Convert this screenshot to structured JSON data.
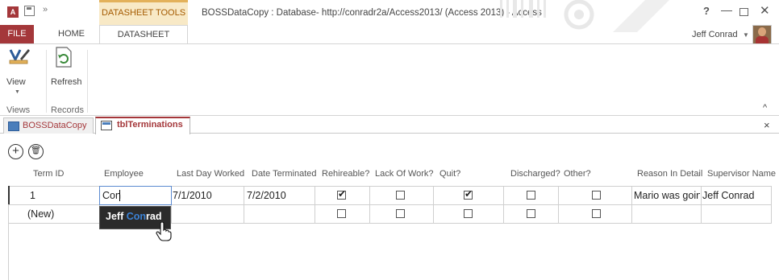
{
  "app": {
    "icon_text": "A",
    "tools_context": "DATASHEET TOOLS",
    "window_title": "BOSSDataCopy : Database- http://conradr2a/Access2013/ (Access 2013) - Access",
    "help": "?",
    "qat_more": "»"
  },
  "ribbon": {
    "tabs": [
      {
        "label": "FILE"
      },
      {
        "label": "HOME"
      },
      {
        "label": "DATASHEET"
      }
    ],
    "user_name": "Jeff Conrad",
    "view_label": "View",
    "refresh_label": "Refresh",
    "groups": {
      "views": "Views",
      "records": "Records"
    },
    "collapse": "^"
  },
  "doc_tabs": [
    {
      "label": "BOSSDataCopy"
    },
    {
      "label": "tblTerminations"
    }
  ],
  "doc_close": "×",
  "columns": [
    "Term ID",
    "Employee",
    "Last Day Worked",
    "Date Terminated",
    "Rehireable?",
    "Lack Of Work?",
    "Quit?",
    "Discharged?",
    "Other?",
    "Reason In Detail",
    "Supervisor Name"
  ],
  "rows": [
    {
      "term_id": "1",
      "employee": "Con",
      "last_day": "7/1/2010",
      "date_term": "7/2/2010",
      "rehireable": true,
      "lack_of_work": false,
      "quit": true,
      "discharged": false,
      "other": false,
      "reason": "Mario was goin",
      "supervisor": "Jeff Conrad"
    },
    {
      "term_id": "(New)",
      "employee": "",
      "last_day": "",
      "date_term": "",
      "rehireable": false,
      "lack_of_work": false,
      "quit": false,
      "discharged": false,
      "other": false,
      "reason": "",
      "supervisor": ""
    }
  ],
  "autocomplete": {
    "prefix": "Jeff ",
    "match": "Con",
    "suffix": "rad"
  },
  "icons": {
    "add": "plus-circle-icon",
    "delete": "trash-circle-icon"
  },
  "colors": {
    "accent": "#a4373a",
    "context": "#f8e9c6",
    "focus": "#5b8ad0"
  }
}
